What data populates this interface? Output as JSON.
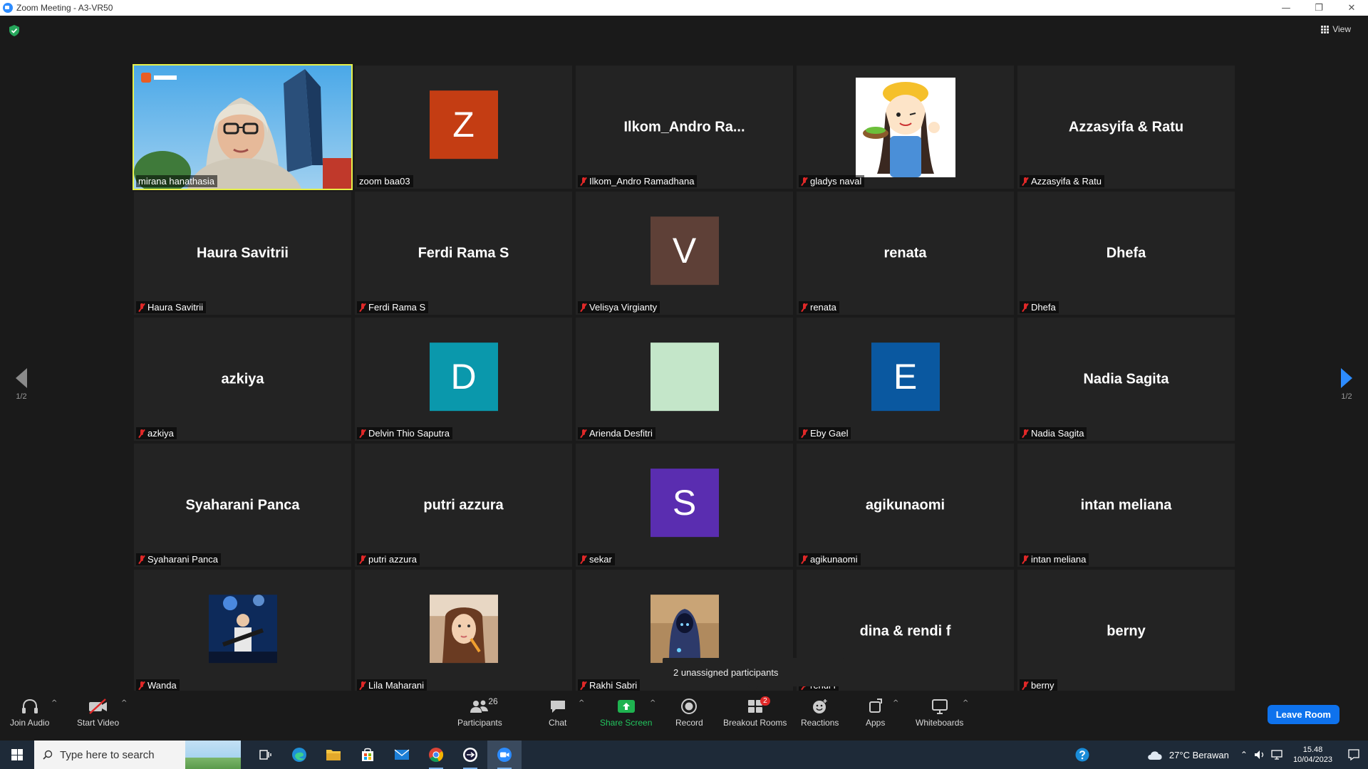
{
  "window": {
    "title": "Zoom Meeting - A3-VR50",
    "minimize": "—",
    "restore": "❐",
    "close": "✕"
  },
  "view_label": "View",
  "pagination": {
    "left": "1/2",
    "right": "1/2"
  },
  "tiles": [
    {
      "type": "video",
      "big": "",
      "label": "mirana hanathasia",
      "muted": false,
      "active": true
    },
    {
      "type": "letter",
      "big": "Z",
      "color": "#c43d13",
      "label": "zoom baa03",
      "muted": false
    },
    {
      "type": "name",
      "big": "Ilkom_Andro  Ra...",
      "label": "Ilkom_Andro Ramadhana",
      "muted": true
    },
    {
      "type": "image",
      "big": "",
      "label": "gladys naval",
      "muted": true,
      "pic": "cartoon-chef"
    },
    {
      "type": "name",
      "big": "Azzasyifa & Ratu",
      "label": "Azzasyifa & Ratu",
      "muted": true
    },
    {
      "type": "name",
      "big": "Haura Savitrii",
      "label": "Haura Savitrii",
      "muted": true
    },
    {
      "type": "name",
      "big": "Ferdi Rama S",
      "label": "Ferdi Rama S",
      "muted": true
    },
    {
      "type": "letter",
      "big": "V",
      "color": "#5e4037",
      "label": "Velisya Virgianty",
      "muted": true
    },
    {
      "type": "name",
      "big": "renata",
      "label": "renata",
      "muted": true
    },
    {
      "type": "name",
      "big": "Dhefa",
      "label": "Dhefa",
      "muted": true
    },
    {
      "type": "name",
      "big": "azkiya",
      "label": "azkiya",
      "muted": true
    },
    {
      "type": "letter",
      "big": "D",
      "color": "#0a98ac",
      "label": "Delvin Thio Saputra",
      "muted": true
    },
    {
      "type": "letter",
      "big": "",
      "color": "#c4e6c9",
      "label": "Arienda Desfitri",
      "muted": true
    },
    {
      "type": "letter",
      "big": "E",
      "color": "#0a58a0",
      "label": "Eby Gael",
      "muted": true
    },
    {
      "type": "name",
      "big": "Nadia Sagita",
      "label": "Nadia Sagita",
      "muted": true
    },
    {
      "type": "name",
      "big": "Syaharani Panca",
      "label": "Syaharani Panca",
      "muted": true
    },
    {
      "type": "name",
      "big": "putri azzura",
      "label": "putri azzura",
      "muted": true
    },
    {
      "type": "letter",
      "big": "S",
      "color": "#5a2db0",
      "label": "sekar",
      "muted": true
    },
    {
      "type": "name",
      "big": "agikunaomi",
      "label": "agikunaomi",
      "muted": true
    },
    {
      "type": "name",
      "big": "intan meliana",
      "label": "intan meliana",
      "muted": true
    },
    {
      "type": "image",
      "big": "",
      "label": "Wanda",
      "muted": true,
      "pic": "concert-photo"
    },
    {
      "type": "image",
      "big": "",
      "label": "Lila Maharani",
      "muted": true,
      "pic": "selfie-photo"
    },
    {
      "type": "image",
      "big": "",
      "label": "Rakhi Sabri",
      "muted": true,
      "pic": "hooded-figure"
    },
    {
      "type": "name",
      "big": "dina & rendi f",
      "label": "rendi f",
      "muted": true
    },
    {
      "type": "name",
      "big": "berny",
      "label": "berny",
      "muted": true
    }
  ],
  "tooltip": "2 unassigned participants",
  "toolbar": {
    "join_audio": "Join Audio",
    "start_video": "Start Video",
    "participants": "Participants",
    "participants_count": "26",
    "chat": "Chat",
    "share_screen": "Share Screen",
    "record": "Record",
    "breakout_rooms": "Breakout Rooms",
    "breakout_badge": "2",
    "reactions": "Reactions",
    "apps": "Apps",
    "whiteboards": "Whiteboards",
    "leave_room": "Leave Room",
    "caret": "^"
  },
  "taskbar": {
    "search_placeholder": "Type here to search",
    "weather": "27°C  Berawan",
    "time": "15.48",
    "date": "10/04/2023"
  }
}
